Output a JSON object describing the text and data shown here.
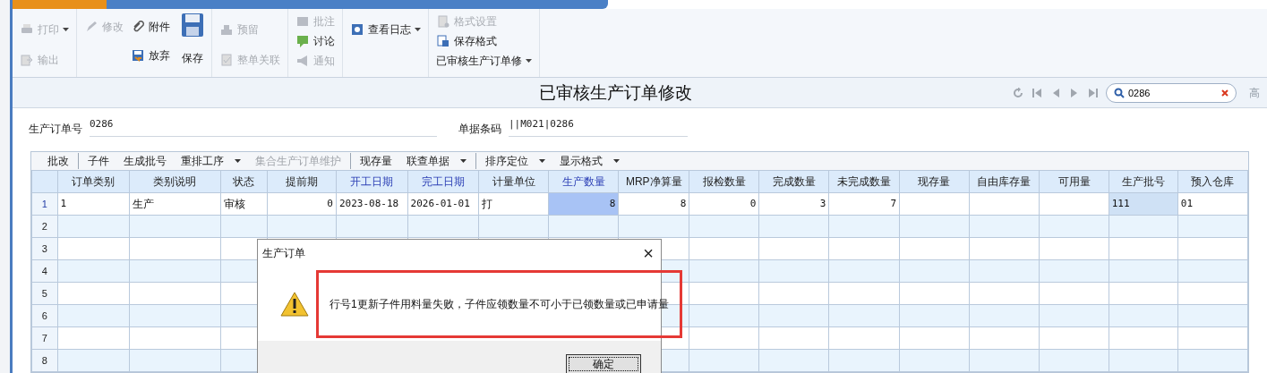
{
  "toolbar": {
    "groups": [
      {
        "items": [
          {
            "label": "打印",
            "disabled": true,
            "dropdown": true
          },
          {
            "label": "输出",
            "disabled": true,
            "dropdown": false
          }
        ]
      },
      {
        "items": [
          {
            "label": "修改",
            "disabled": true,
            "dropdown": false
          },
          {
            "label": "附件",
            "disabled": false,
            "dropdown": false
          },
          {
            "label": "放弃",
            "disabled": false,
            "dropdown": false
          },
          {
            "label": "保存",
            "disabled": false
          }
        ]
      },
      {
        "items": [
          {
            "label": "预留",
            "disabled": true,
            "dropdown": false
          },
          {
            "label": "整单关联",
            "disabled": true,
            "dropdown": false
          }
        ]
      },
      {
        "items": [
          {
            "label": "批注",
            "disabled": true,
            "dropdown": false
          },
          {
            "label": "讨论",
            "disabled": false,
            "dropdown": false
          },
          {
            "label": "通知",
            "disabled": true,
            "dropdown": false
          }
        ]
      },
      {
        "items": [
          {
            "label": "查看日志",
            "disabled": false,
            "dropdown": true
          }
        ]
      },
      {
        "items": [
          {
            "label": "格式设置",
            "disabled": true,
            "dropdown": false
          },
          {
            "label": "保存格式",
            "disabled": false,
            "dropdown": false
          },
          {
            "label": "已审核生产订单修",
            "disabled": false,
            "dropdown": true
          }
        ]
      }
    ]
  },
  "title": "已审核生产订单修改",
  "search": {
    "value": "0286"
  },
  "advanced_link": "高",
  "form": [
    {
      "label": "生产订单号",
      "value": "0286"
    },
    {
      "label": "单据条码",
      "value": "||M021|0286"
    }
  ],
  "grid_toolbar": {
    "groups": [
      [
        {
          "label": "批改",
          "disabled": false,
          "dropdown": false
        }
      ],
      [
        {
          "label": "子件",
          "disabled": false,
          "dropdown": false
        },
        {
          "label": "生成批号",
          "disabled": false,
          "dropdown": false
        },
        {
          "label": "重排工序",
          "disabled": false,
          "dropdown": true
        },
        {
          "label": "集合生产订单维护",
          "disabled": true,
          "dropdown": false
        }
      ],
      [
        {
          "label": "现存量",
          "disabled": false,
          "dropdown": false
        },
        {
          "label": "联查单据",
          "disabled": false,
          "dropdown": true
        }
      ],
      [
        {
          "label": "排序定位",
          "disabled": false,
          "dropdown": true
        },
        {
          "label": "显示格式",
          "disabled": false,
          "dropdown": true
        }
      ]
    ]
  },
  "table": {
    "columns": [
      {
        "label": "订单类别",
        "highlighted": false,
        "kind": "text"
      },
      {
        "label": "类别说明",
        "highlighted": false,
        "kind": "text"
      },
      {
        "label": "状态",
        "highlighted": false,
        "kind": "text"
      },
      {
        "label": "提前期",
        "highlighted": false,
        "kind": "number"
      },
      {
        "label": "开工日期",
        "highlighted": true,
        "kind": "text"
      },
      {
        "label": "完工日期",
        "highlighted": true,
        "kind": "text"
      },
      {
        "label": "计量单位",
        "highlighted": false,
        "kind": "text"
      },
      {
        "label": "生产数量",
        "highlighted": true,
        "kind": "number"
      },
      {
        "label": "MRP净算量",
        "highlighted": false,
        "kind": "number"
      },
      {
        "label": "报检数量",
        "highlighted": false,
        "kind": "number"
      },
      {
        "label": "完成数量",
        "highlighted": false,
        "kind": "number"
      },
      {
        "label": "未完成数量",
        "highlighted": false,
        "kind": "number"
      },
      {
        "label": "现存量",
        "highlighted": false,
        "kind": "number"
      },
      {
        "label": "自由库存量",
        "highlighted": false,
        "kind": "number"
      },
      {
        "label": "可用量",
        "highlighted": false,
        "kind": "number"
      },
      {
        "label": "生产批号",
        "highlighted": false,
        "kind": "text"
      },
      {
        "label": "预入仓库",
        "highlighted": false,
        "kind": "text"
      }
    ],
    "rows": [
      {
        "number": "1",
        "cells": [
          {
            "text": "1",
            "selected": false,
            "highlighted": false
          },
          {
            "text": "生产",
            "selected": false,
            "highlighted": false
          },
          {
            "text": "审核",
            "selected": false,
            "highlighted": false
          },
          {
            "text": "0",
            "selected": false,
            "highlighted": false
          },
          {
            "text": "2023-08-18",
            "selected": false,
            "highlighted": false
          },
          {
            "text": "2026-01-01",
            "selected": false,
            "highlighted": false
          },
          {
            "text": "打",
            "selected": false,
            "highlighted": false
          },
          {
            "text": "8",
            "selected": true,
            "highlighted": false
          },
          {
            "text": "8",
            "selected": false,
            "highlighted": false
          },
          {
            "text": "0",
            "selected": false,
            "highlighted": false
          },
          {
            "text": "3",
            "selected": false,
            "highlighted": false
          },
          {
            "text": "7",
            "selected": false,
            "highlighted": false
          },
          {
            "selected": false,
            "highlighted": false
          },
          {
            "selected": false,
            "highlighted": false
          },
          {
            "selected": false,
            "highlighted": false
          },
          {
            "text": "111",
            "selected": false,
            "highlighted": true
          },
          {
            "text": "01",
            "selected": false,
            "highlighted": false
          }
        ]
      },
      {
        "number": "2"
      },
      {
        "number": "3"
      },
      {
        "number": "4"
      },
      {
        "number": "5"
      },
      {
        "number": "6"
      },
      {
        "number": "7"
      },
      {
        "number": "8"
      }
    ]
  },
  "dialog": {
    "title": "生产订单",
    "close": "×",
    "message": "行号1更新子件用料量失败，子件应领数量不可小于已领数量或已申请量",
    "message_highlighted": true,
    "button": "确定"
  }
}
